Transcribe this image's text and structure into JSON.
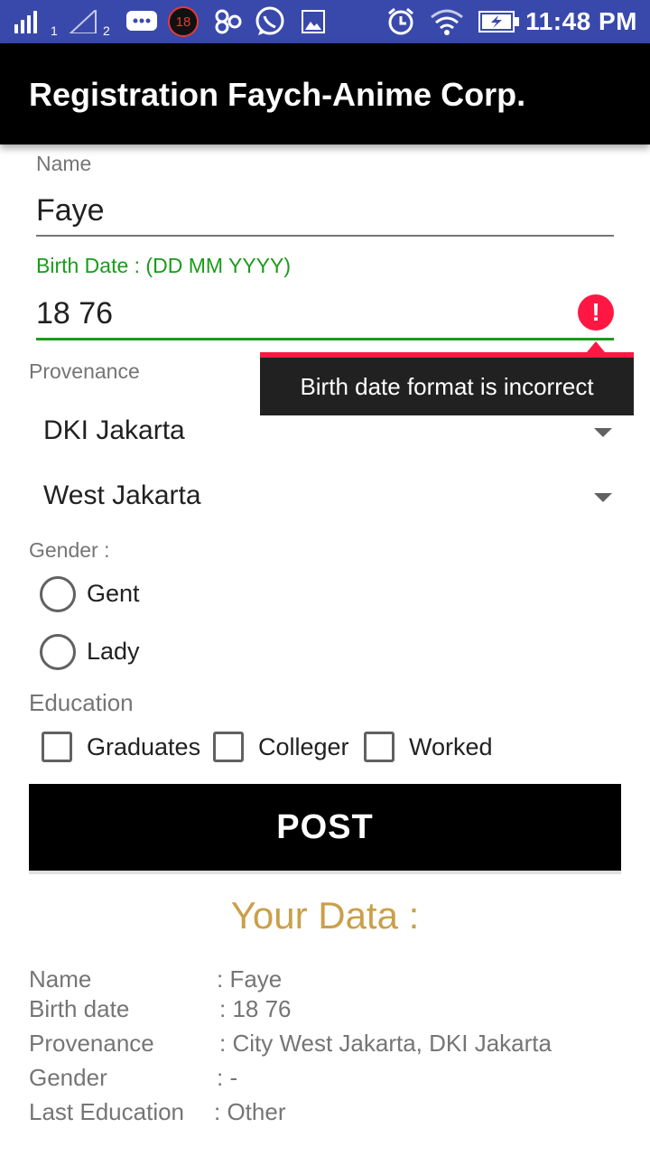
{
  "status_bar": {
    "sim1": "1",
    "sim2": "2",
    "notification_badge": "18",
    "time": "11:48 PM",
    "icons": [
      "signal-icon",
      "no-signal-icon",
      "message-icon",
      "badge-icon",
      "app-icon",
      "whatsapp-icon",
      "image-icon",
      "alarm-icon",
      "wifi-icon",
      "battery-icon"
    ]
  },
  "app_bar": {
    "title": "Registration Faych-Anime Corp."
  },
  "form": {
    "name_label": "Name",
    "name_value": "Faye",
    "birth_label": "Birth Date : (DD MM YYYY)",
    "birth_value": "18 76",
    "birth_error_icon": "!",
    "birth_error": "Birth date format is incorrect",
    "provenance_label": "Provenance",
    "province": "DKI Jakarta",
    "city": "West Jakarta",
    "gender_label": "Gender :",
    "gender_options": [
      "Gent",
      "Lady"
    ],
    "education_label": "Education",
    "education_options": [
      "Graduates",
      "Colleger",
      "Worked"
    ],
    "post_label": "POST"
  },
  "summary": {
    "heading": "Your Data :",
    "rows": [
      {
        "label": "Name",
        "value": ": Faye"
      },
      {
        "label": "Birth date",
        "value": ": 18 76"
      },
      {
        "label": "Provenance",
        "value": ": City West Jakarta, DKI Jakarta"
      },
      {
        "label": "Gender",
        "value": ": -"
      },
      {
        "label": "Last Education",
        "value": ": Other"
      }
    ]
  },
  "colors": {
    "status_bar": "#3949ab",
    "app_bar": "#000000",
    "accent_green": "#1a9c1a",
    "error_red": "#ff1744",
    "heading_gold": "#c9a04a"
  }
}
